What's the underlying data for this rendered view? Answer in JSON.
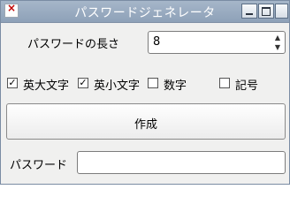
{
  "window": {
    "title": "パスワードジェネレータ"
  },
  "length": {
    "label": "パスワードの長さ",
    "value": "8"
  },
  "checkboxes": [
    {
      "label": "英大文字",
      "checked": true,
      "mark": "✓"
    },
    {
      "label": "英小文字",
      "checked": true,
      "mark": "✓"
    },
    {
      "label": "数字",
      "checked": false,
      "mark": ""
    },
    {
      "label": "記号",
      "checked": false,
      "mark": ""
    }
  ],
  "generate_button": "作成",
  "password": {
    "label": "パスワード",
    "value": ""
  },
  "icons": {
    "app": "x-app-icon",
    "minimize": "minimize-icon",
    "maximize": "maximize-icon"
  },
  "colors": {
    "titlebar": "#98a9be",
    "window_bg": "#f0f0ef"
  }
}
